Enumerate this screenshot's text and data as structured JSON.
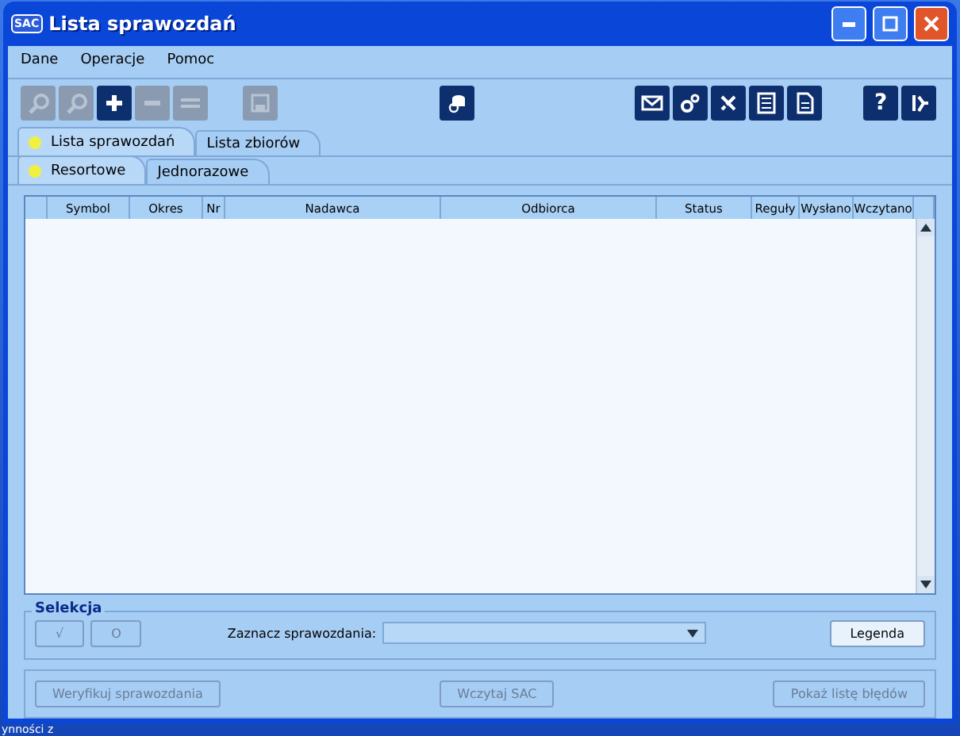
{
  "window": {
    "title": "Lista sprawozdań",
    "app_badge": "SAC"
  },
  "menu": [
    "Dane",
    "Operacje",
    "Pomoc"
  ],
  "toolbar": {
    "left": [
      {
        "disabled": true
      },
      {
        "disabled": true
      },
      {
        "disabled": false
      },
      {
        "disabled": true
      },
      {
        "disabled": true
      },
      {
        "disabled": true
      }
    ],
    "right": [
      {
        "disabled": false
      },
      {
        "disabled": false
      },
      {
        "disabled": false
      },
      {
        "disabled": false
      },
      {
        "disabled": false
      }
    ],
    "help": "?"
  },
  "tabs": [
    {
      "label": "Lista sprawozdań",
      "selected": true
    },
    {
      "label": "Lista zbiorów",
      "selected": false
    }
  ],
  "subtabs": [
    {
      "label": "Resortowe",
      "selected": true
    },
    {
      "label": "Jednorazowe",
      "selected": false
    }
  ],
  "table": {
    "columns": [
      "Symbol",
      "Okres",
      "Nr",
      "Nadawca",
      "Odbiorca",
      "Status",
      "Reguły",
      "Wysłano",
      "Wczytano"
    ]
  },
  "selection": {
    "title": "Selekcja",
    "check_button": "√",
    "clear_button": "O",
    "combo_label": "Zaznacz sprawozdania:",
    "legend_button": "Legenda"
  },
  "actions": [
    {
      "label": "Weryfikuj sprawozdania",
      "disabled": true
    },
    {
      "label": "Wczytaj SAC",
      "disabled": true
    },
    {
      "label": "Pokaż listę błędów",
      "disabled": true
    }
  ],
  "desktop_text": "ynności z"
}
